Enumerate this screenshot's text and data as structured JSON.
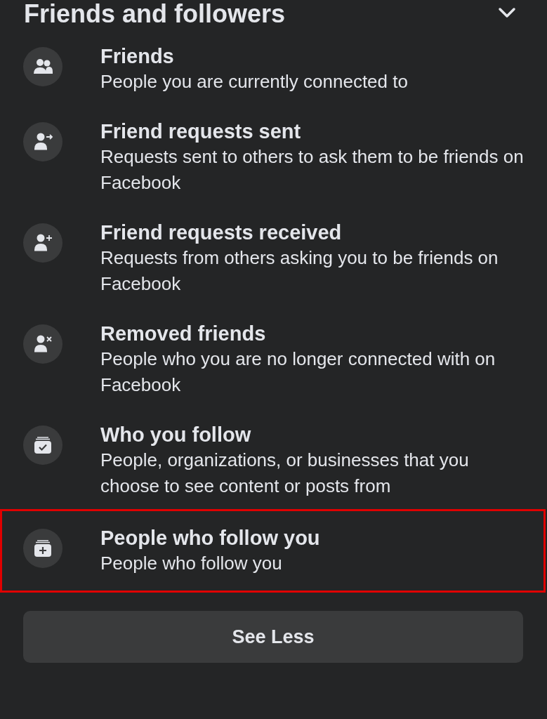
{
  "section": {
    "title": "Friends and followers",
    "expanded": true
  },
  "items": [
    {
      "kind": "friends",
      "title": "Friends",
      "description": "People you are currently connected to",
      "highlighted": false
    },
    {
      "kind": "sent",
      "title": "Friend requests sent",
      "description": "Requests sent to others to ask them to be friends on Facebook",
      "highlighted": false
    },
    {
      "kind": "received",
      "title": "Friend requests received",
      "description": "Requests from others asking you to be friends on Facebook",
      "highlighted": false
    },
    {
      "kind": "removed",
      "title": "Removed friends",
      "description": "People who you are no longer connected with on Facebook",
      "highlighted": false
    },
    {
      "kind": "following",
      "title": "Who you follow",
      "description": "People, organizations, or businesses that you choose to see content or posts from",
      "highlighted": false
    },
    {
      "kind": "followers",
      "title": "People who follow you",
      "description": "People who follow you",
      "highlighted": true
    }
  ],
  "button": {
    "label": "See Less"
  }
}
